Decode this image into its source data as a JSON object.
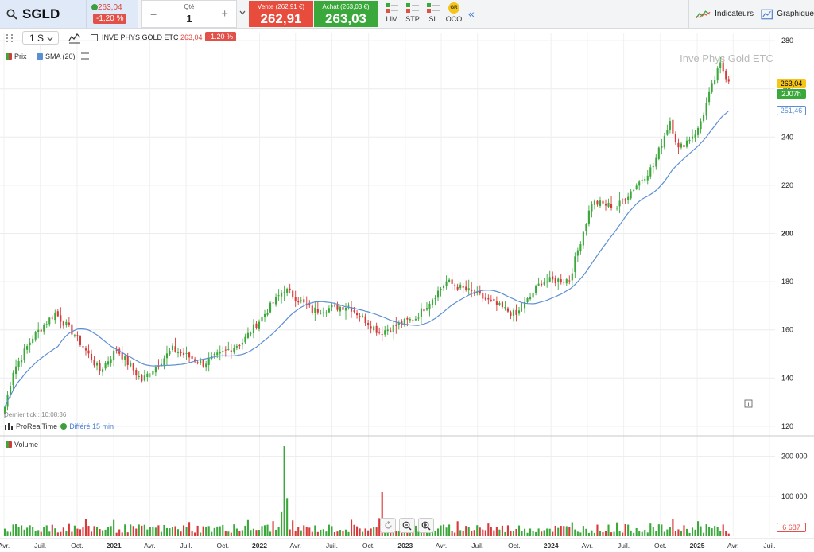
{
  "topbar": {
    "symbol": "SGLD",
    "last_price": "263,04",
    "change": "-1,20 %",
    "qty_label": "Qté",
    "qty_value": "1",
    "qty_minus": "−",
    "qty_plus": "+",
    "sell_label": "Vente (262,91 €)",
    "sell_price": "262,91",
    "buy_label": "Achat (263,03 €)",
    "buy_price": "263,03",
    "order_types": [
      "LIM",
      "STP",
      "SL",
      "OCO"
    ],
    "oco_badge": "GR",
    "collapse": "«",
    "indicators": "Indicateurs",
    "chart": "Graphique"
  },
  "toolbar": {
    "interval": "1 S",
    "instrument_name": "INVE PHYS GOLD ETC",
    "instrument_price": "263,04",
    "instrument_change": "-1.20 %"
  },
  "legend": {
    "price": "Prix",
    "sma": "SMA (20)",
    "volume": "Volume"
  },
  "watermark": "Inve Phys Gold ETC",
  "last_tick": "Dernier tick : 10:08:36",
  "provider": "ProRealTime",
  "delay": "Différé 15 min",
  "colors": {
    "up": "#3aa83a",
    "down": "#d63a3a",
    "sma": "#5b8fd4",
    "last_price_bg": "#f5c518",
    "timer_bg": "#3aa83a",
    "sell": "#e74c3c",
    "buy": "#3aa83a"
  },
  "chart_data": [
    {
      "type": "candlestick",
      "title": "",
      "xlabel": "",
      "ylabel": "",
      "ylim": [
        117,
        283
      ],
      "yticks": [
        120,
        140,
        160,
        180,
        200,
        220,
        240,
        260,
        280
      ],
      "ytick_labels": [
        "120",
        "140",
        "160",
        "180",
        "200",
        "220",
        "240",
        "260",
        "280"
      ],
      "bold_yticks": [
        200
      ],
      "x_range": [
        "2020-04-01",
        "2025-07-15"
      ],
      "x_ticks": [
        {
          "date": "2020-04-01",
          "label": "Avr."
        },
        {
          "date": "2020-07-01",
          "label": "Juil."
        },
        {
          "date": "2020-10-01",
          "label": "Oct."
        },
        {
          "date": "2021-01-01",
          "label": "2021"
        },
        {
          "date": "2021-04-01",
          "label": "Avr."
        },
        {
          "date": "2021-07-01",
          "label": "Juil."
        },
        {
          "date": "2021-10-01",
          "label": "Oct."
        },
        {
          "date": "2022-01-01",
          "label": "2022"
        },
        {
          "date": "2022-04-01",
          "label": "Avr."
        },
        {
          "date": "2022-07-01",
          "label": "Juil."
        },
        {
          "date": "2022-10-01",
          "label": "Oct."
        },
        {
          "date": "2023-01-01",
          "label": "2023"
        },
        {
          "date": "2023-04-01",
          "label": "Avr."
        },
        {
          "date": "2023-07-01",
          "label": "Juil."
        },
        {
          "date": "2023-10-01",
          "label": "Oct."
        },
        {
          "date": "2024-01-01",
          "label": "2024"
        },
        {
          "date": "2024-04-01",
          "label": "Avr."
        },
        {
          "date": "2024-07-01",
          "label": "Juil."
        },
        {
          "date": "2024-10-01",
          "label": "Oct."
        },
        {
          "date": "2025-01-01",
          "label": "2025"
        },
        {
          "date": "2025-04-01",
          "label": "Avr."
        },
        {
          "date": "2025-07-01",
          "label": "Juil."
        }
      ],
      "bold_xticks": [
        "2021",
        "2022",
        "2023",
        "2024",
        "2025"
      ],
      "series": [
        {
          "name": "Prix",
          "type": "candlestick",
          "interval": "weekly",
          "start": "2020-04-03",
          "end": "2025-03-21",
          "anchors": [
            {
              "date": "2020-04-03",
              "close": 128
            },
            {
              "date": "2020-04-24",
              "close": 143
            },
            {
              "date": "2020-06-12",
              "close": 157
            },
            {
              "date": "2020-08-07",
              "close": 167
            },
            {
              "date": "2020-09-25",
              "close": 158
            },
            {
              "date": "2020-11-27",
              "close": 143
            },
            {
              "date": "2021-01-08",
              "close": 152
            },
            {
              "date": "2021-03-12",
              "close": 139
            },
            {
              "date": "2021-05-28",
              "close": 152
            },
            {
              "date": "2021-08-13",
              "close": 146
            },
            {
              "date": "2021-11-19",
              "close": 155
            },
            {
              "date": "2022-03-04",
              "close": 177
            },
            {
              "date": "2022-05-13",
              "close": 168
            },
            {
              "date": "2022-08-12",
              "close": 170
            },
            {
              "date": "2022-10-28",
              "close": 159
            },
            {
              "date": "2023-01-27",
              "close": 165
            },
            {
              "date": "2023-04-14",
              "close": 180
            },
            {
              "date": "2023-06-23",
              "close": 175
            },
            {
              "date": "2023-10-06",
              "close": 166
            },
            {
              "date": "2023-12-08",
              "close": 180
            },
            {
              "date": "2024-02-16",
              "close": 181
            },
            {
              "date": "2024-04-12",
              "close": 213
            },
            {
              "date": "2024-06-14",
              "close": 211
            },
            {
              "date": "2024-09-13",
              "close": 228
            },
            {
              "date": "2024-10-25",
              "close": 247
            },
            {
              "date": "2024-11-15",
              "close": 235
            },
            {
              "date": "2025-01-03",
              "close": 243
            },
            {
              "date": "2025-02-07",
              "close": 261
            },
            {
              "date": "2025-02-28",
              "close": 270
            },
            {
              "date": "2025-03-21",
              "close": 263.04
            }
          ]
        },
        {
          "name": "SMA (20)",
          "type": "line",
          "period": 20
        }
      ],
      "last_price": 263.04,
      "last_price_label": "263,04",
      "candle_timer": "2J07h",
      "sma_last_label": "251,46",
      "grid": true
    },
    {
      "type": "bar",
      "title": "",
      "series": [
        {
          "name": "Volume",
          "values_note": ""
        }
      ],
      "ylim": [
        0,
        245000
      ],
      "yticks": [
        100000,
        200000
      ],
      "ytick_labels": [
        "100 000",
        "200 000"
      ],
      "volume_spikes": [
        {
          "date": "2022-03-04",
          "value": 225000
        },
        {
          "date": "2022-03-11",
          "value": 95000
        },
        {
          "date": "2022-02-25",
          "value": 60000
        },
        {
          "date": "2022-11-04",
          "value": 110000
        },
        {
          "date": "2022-10-28",
          "value": 45000
        }
      ],
      "typical_volume": [
        8000,
        30000
      ],
      "last_volume": 6687,
      "last_volume_label": "6 687"
    }
  ]
}
